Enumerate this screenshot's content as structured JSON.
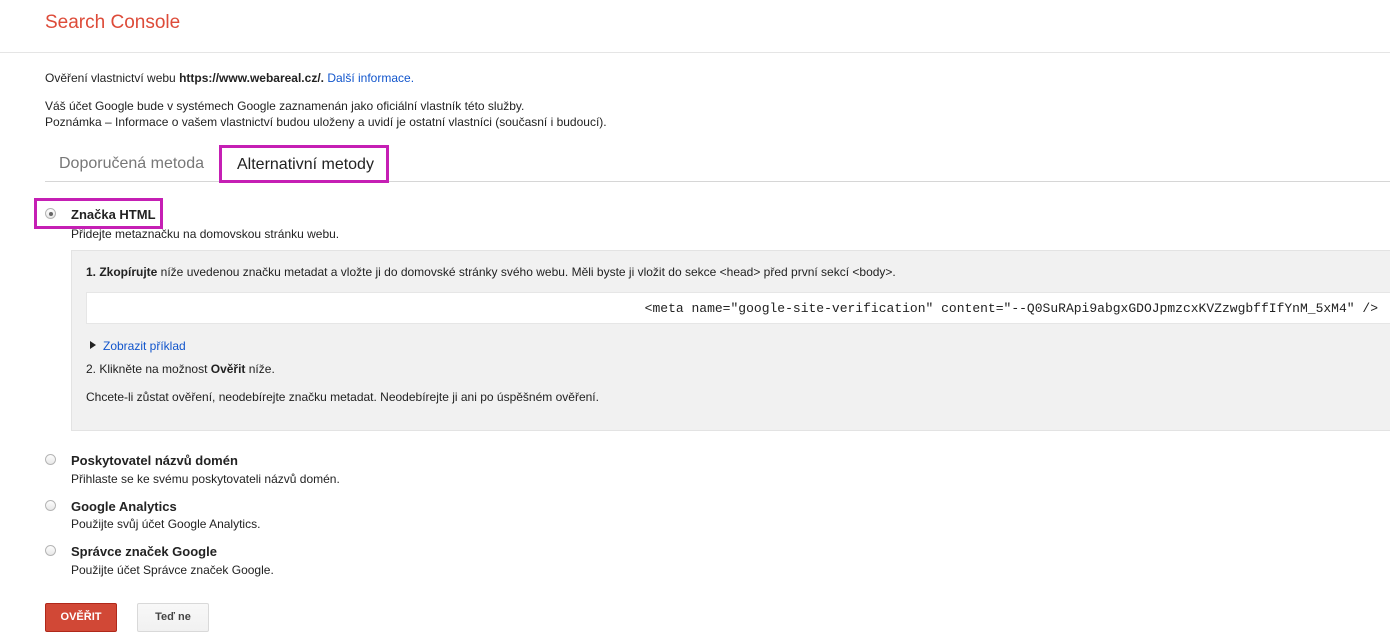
{
  "header": {
    "brand": "Search Console"
  },
  "intro": {
    "prefix": "Ověření vlastnictví webu ",
    "url": "https://www.webareal.cz/.",
    "more_link": "Další informace."
  },
  "note": {
    "line1": "Váš účet Google bude v systémech Google zaznamenán jako oficiální vlastník této služby.",
    "line2": "Poznámka – Informace o vašem vlastnictví budou uloženy a uvidí je ostatní vlastníci (současní i budoucí)."
  },
  "tabs": [
    {
      "label": "Doporučená metoda",
      "active": false
    },
    {
      "label": "Alternativní metody",
      "active": true
    }
  ],
  "methods": [
    {
      "title": "Značka HTML",
      "description": "Přidejte metaznačku na domovskou stránku webu.",
      "selected": true
    },
    {
      "title": "Poskytovatel názvů domén",
      "description": "Přihlaste se ke svému poskytovateli názvů domén.",
      "selected": false
    },
    {
      "title": "Google Analytics",
      "description": "Použijte svůj účet Google Analytics.",
      "selected": false
    },
    {
      "title": "Správce značek Google",
      "description": "Použijte účet Správce značek Google.",
      "selected": false
    }
  ],
  "html_tag_panel": {
    "step1_bold": "1. Zkopírujte",
    "step1_rest": " níže uvedenou značku metadat a vložte ji do domovské stránky svého webu. Měli byste ji vložit do sekce <head> před první sekcí <body>.",
    "meta_tag": "<meta name=\"google-site-verification\" content=\"--Q0SuRApi9abgxGDOJpmzcxKVZzwgbffIfYnM_5xM4\" />",
    "show_example": "Zobrazit příklad",
    "step2_prefix": "2. Klikněte na možnost ",
    "step2_bold": "Ověřit",
    "step2_suffix": " níže.",
    "warning": "Chcete-li zůstat ověření, neodebírejte značku metadat. Neodebírejte ji ani po úspěšném ověření."
  },
  "buttons": {
    "verify": "OVĚŘIT",
    "later": "Teď ne"
  },
  "colors": {
    "brand": "#dd4b39",
    "link": "#1155cc",
    "highlight": "#c51fb4",
    "primary_button": "#d14836"
  }
}
